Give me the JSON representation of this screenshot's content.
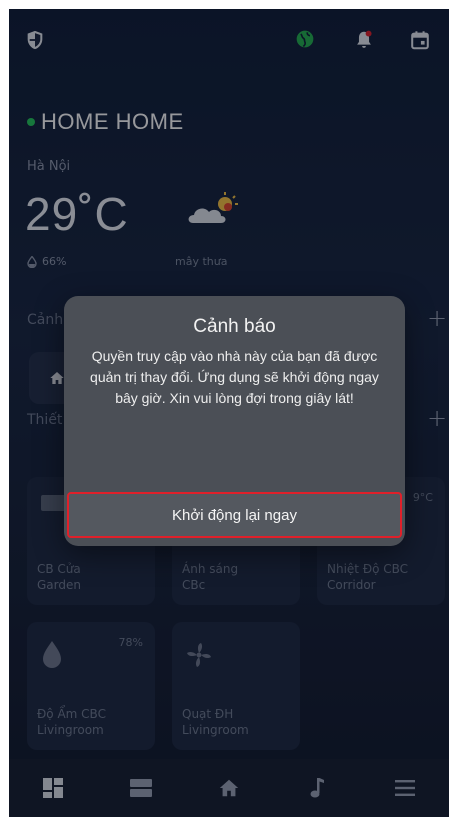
{
  "home": {
    "title": "HOME HOME",
    "status_color": "#24c75a"
  },
  "weather": {
    "city": "Hà Nội",
    "temperature": "29˚C",
    "humidity": "66%",
    "description": "mây thưa",
    "icon": "partly-cloudy-icon"
  },
  "sections": {
    "scenes_label": "Cảnh",
    "devices_label": "Thiết",
    "add_symbol": "+"
  },
  "devices": [
    {
      "name_line1": "CB Cửa",
      "name_line2": "Garden",
      "icon": "switch-icon",
      "value": ""
    },
    {
      "name_line1": "Ánh sáng",
      "name_line2": "CBc",
      "icon": "light-icon",
      "value": ""
    },
    {
      "name_line1": "Nhiệt Độ CBC",
      "name_line2": "Corridor",
      "icon": "thermometer-icon",
      "value": "9°C"
    },
    {
      "name_line1": "Độ Ẩm CBC",
      "name_line2": "Livingroom",
      "icon": "water-drop-icon",
      "value": "78%"
    },
    {
      "name_line1": "Quạt ĐH",
      "name_line2": "Livingroom",
      "icon": "fan-icon",
      "value": ""
    }
  ],
  "bottom_nav": [
    {
      "icon": "dashboard-icon"
    },
    {
      "icon": "list-icon"
    },
    {
      "icon": "home-icon"
    },
    {
      "icon": "music-icon"
    },
    {
      "icon": "menu-icon"
    }
  ],
  "dialog": {
    "title": "Cảnh báo",
    "message": "Quyền truy cập vào nhà này của bạn đã được quản trị thay đổi. Ứng dụng sẽ khởi động ngay bây giờ. Xin vui lòng đợi trong giây lát!",
    "button_label": "Khởi động lại ngay",
    "highlight_color": "#e0202a"
  },
  "colors": {
    "background": "#141e33",
    "card": "#1d2840",
    "dialog": "#4b4f56",
    "alert_bell": "#e0202a",
    "globe": "#23b04f"
  }
}
